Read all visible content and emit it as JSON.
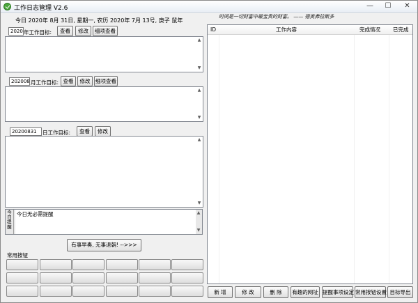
{
  "window": {
    "title": "工作日志管理 V2.6",
    "min": "—",
    "max": "☐",
    "close": "✕"
  },
  "date_line": "今日 2020年 8月 31日, 星期一, 农历 2020年 7月 13号, 庚子 鼠年",
  "motto": "时间是一切财富中最宝贵的财富。 —— 德奥弗拉斯多",
  "year_goal": {
    "value": "2020",
    "label": "年工作目标:",
    "view": "查看",
    "edit": "修改",
    "detail": "细项查看"
  },
  "month_goal": {
    "value": "202008",
    "label": "月工作目标:",
    "view": "查看",
    "edit": "修改",
    "detail": "细项查看"
  },
  "day_goal": {
    "value": "20200831",
    "label": "日工作目标:",
    "view": "查看",
    "edit": "修改"
  },
  "reminder": {
    "side_label": "今日提醒",
    "text": "今日无必需提醒"
  },
  "slogan_button": "有事早奏, 无事退朝! -->>>",
  "common_buttons_label": "常用按钮",
  "table": {
    "columns": [
      "ID",
      "工作内容",
      "完成情况",
      "已完成"
    ]
  },
  "bottom_buttons": [
    "新 增",
    "修 改",
    "删 除",
    "有趣的网址",
    "提醒事项设定",
    "常用按钮设置",
    "目标导出"
  ]
}
